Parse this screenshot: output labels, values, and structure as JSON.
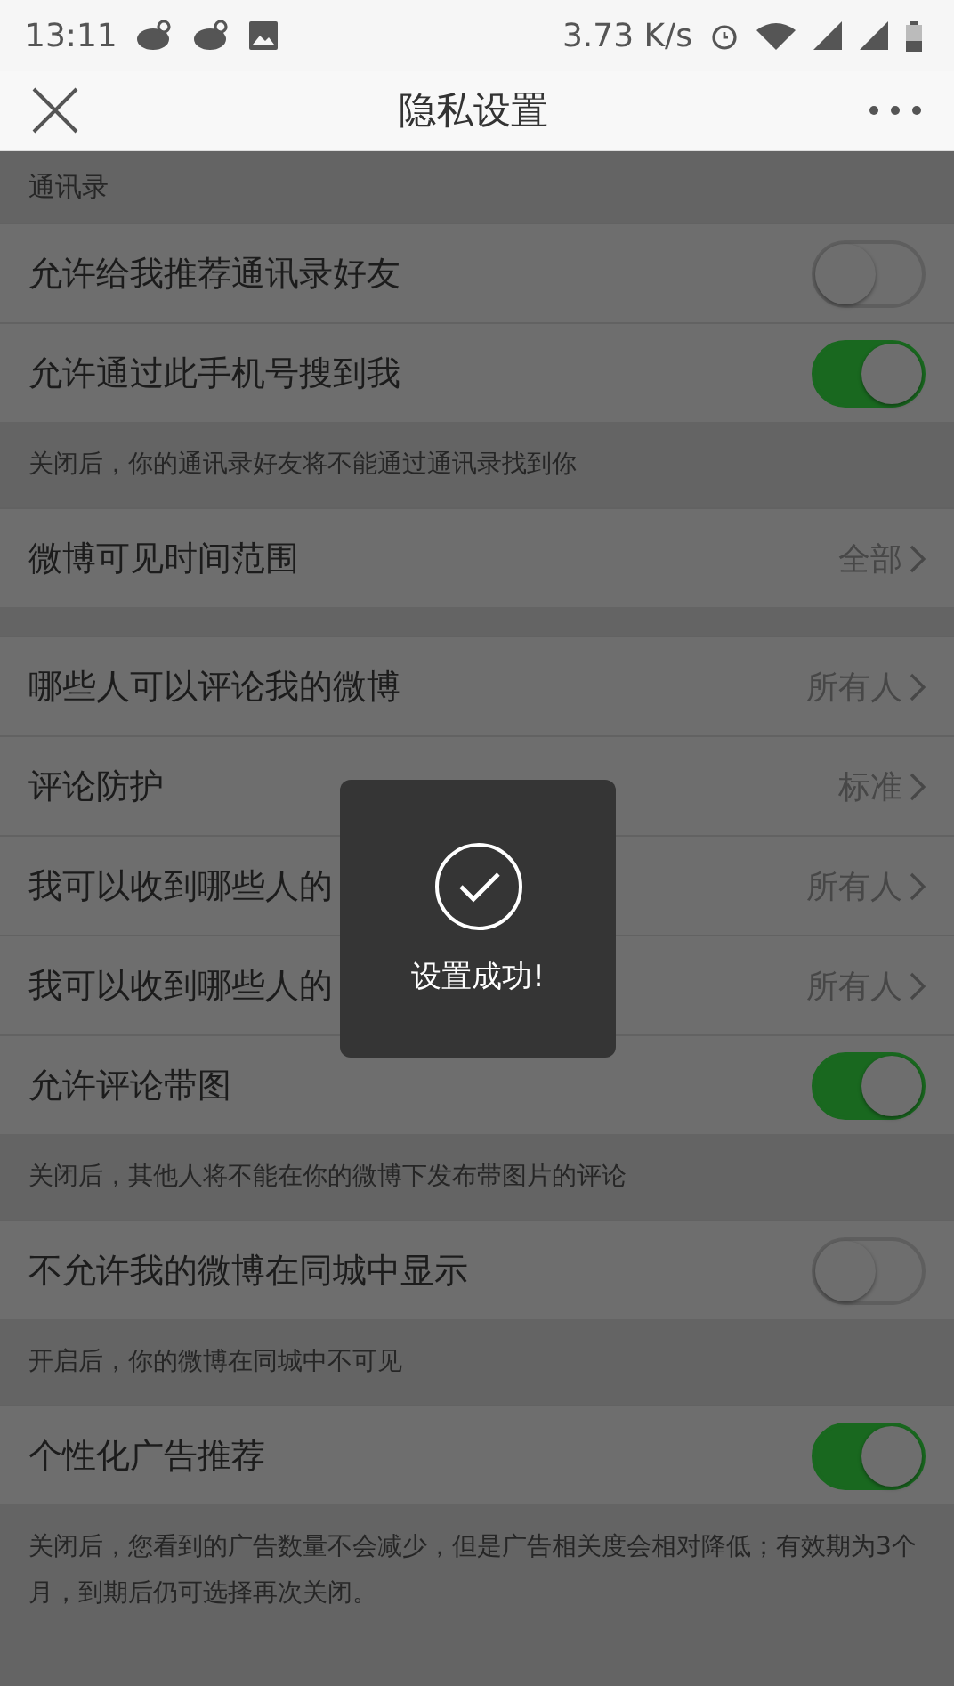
{
  "status_bar": {
    "time": "13:11",
    "speed": "3.73 K/s"
  },
  "nav": {
    "title": "隐私设置"
  },
  "items": [
    {
      "kind": "header",
      "label": "通讯录"
    },
    {
      "kind": "toggle",
      "label": "允许给我推荐通讯录好友",
      "on": false
    },
    {
      "kind": "toggle",
      "label": "允许通过此手机号搜到我",
      "on": true
    },
    {
      "kind": "hint",
      "label": "关闭后，你的通讯录好友将不能通过通讯录找到你"
    },
    {
      "kind": "link",
      "label": "微博可见时间范围",
      "value": "全部"
    },
    {
      "kind": "gap"
    },
    {
      "kind": "link",
      "label": "哪些人可以评论我的微博",
      "value": "所有人"
    },
    {
      "kind": "link",
      "label": "评论防护",
      "value": "标准"
    },
    {
      "kind": "link",
      "label": "我可以收到哪些人的",
      "value": "所有人"
    },
    {
      "kind": "link",
      "label": "我可以收到哪些人的",
      "value": "所有人"
    },
    {
      "kind": "toggle",
      "label": "允许评论带图",
      "on": true
    },
    {
      "kind": "hint",
      "label": "关闭后，其他人将不能在你的微博下发布带图片的评论"
    },
    {
      "kind": "toggle",
      "label": "不允许我的微博在同城中显示",
      "on": false
    },
    {
      "kind": "hint",
      "label": "开启后，你的微博在同城中不可见"
    },
    {
      "kind": "toggle",
      "label": "个性化广告推荐",
      "on": true
    },
    {
      "kind": "hint",
      "label": "关闭后，您看到的广告数量不会减少，但是广告相关度会相对降低；有效期为3个月，到期后仍可选择再次关闭。"
    }
  ],
  "toast": {
    "message": "设置成功!"
  }
}
